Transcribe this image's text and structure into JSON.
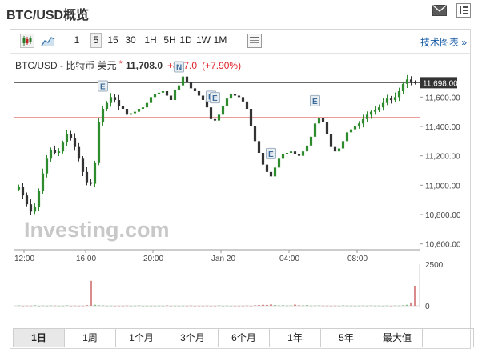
{
  "page": {
    "title": "BTC/USD概览",
    "icons": [
      "mail-icon",
      "document-icon"
    ]
  },
  "toolbar": {
    "chart_type_icons": [
      "candlestick-icon",
      "area-chart-icon"
    ],
    "intervals": [
      "1",
      "5",
      "15",
      "30",
      "1H",
      "5H",
      "1D",
      "1W",
      "1M"
    ],
    "active_interval": "5",
    "settings_icon": "chart-settings-icon",
    "tech_chart_link": "技术图表 »"
  },
  "quote": {
    "name": "BTC/USD - 比特币 美元",
    "star": "*",
    "price": "11,708.0",
    "change": "+857.0",
    "change_pct": "(+7.90%)",
    "up_color": "#e0242b"
  },
  "chart_data": {
    "type": "candlestick",
    "y_ticks": [
      "11,600.00",
      "11,400.00",
      "11,200.00",
      "11,000.00",
      "10,800.00",
      "10,600.00"
    ],
    "y_tick_values": [
      11600,
      11400,
      11200,
      11000,
      10800,
      10600
    ],
    "ylim": [
      10560,
      11760
    ],
    "x_ticks": [
      "12:00",
      "16:00",
      "20:00",
      "Jan 20",
      "04:00",
      "08:00"
    ],
    "current_price_label": "11,698.00",
    "current_price": 11698,
    "reference_line": 11460,
    "event_markers": [
      "E",
      "N",
      "E",
      "E",
      "E",
      "E"
    ],
    "watermark": "Investing.com",
    "closes": [
      10990,
      10930,
      10870,
      10820,
      10850,
      10960,
      11080,
      11180,
      11240,
      11220,
      11230,
      11290,
      11350,
      11320,
      11260,
      11180,
      11090,
      11020,
      11010,
      11150,
      11430,
      11520,
      11560,
      11600,
      11580,
      11540,
      11520,
      11480,
      11490,
      11500,
      11520,
      11530,
      11560,
      11600,
      11620,
      11630,
      11640,
      11610,
      11580,
      11650,
      11680,
      11740,
      11700,
      11660,
      11640,
      11610,
      11580,
      11530,
      11450,
      11440,
      11480,
      11540,
      11590,
      11620,
      11610,
      11600,
      11570,
      11520,
      11400,
      11300,
      11220,
      11140,
      11090,
      11060,
      11120,
      11180,
      11210,
      11220,
      11230,
      11210,
      11200,
      11230,
      11270,
      11330,
      11420,
      11460,
      11430,
      11350,
      11260,
      11230,
      11250,
      11300,
      11360,
      11380,
      11400,
      11420,
      11450,
      11480,
      11500,
      11510,
      11530,
      11560,
      11590,
      11580,
      11600,
      11640,
      11690,
      11720,
      11700,
      11698
    ],
    "volume_axis": [
      "2500",
      "0"
    ],
    "volume_max": 2500,
    "volumes": [
      20,
      0,
      10,
      5,
      30,
      0,
      15,
      0,
      20,
      10,
      0,
      5,
      25,
      0,
      10,
      0,
      5,
      40,
      1500,
      60,
      30,
      20,
      0,
      10,
      0,
      5,
      0,
      15,
      0,
      10,
      20,
      0,
      5,
      0,
      0,
      10,
      0,
      20,
      0,
      5,
      0,
      10,
      0,
      15,
      0,
      5,
      0,
      10,
      0,
      0,
      20,
      0,
      10,
      0,
      5,
      0,
      0,
      15,
      0,
      30,
      40,
      60,
      50,
      80,
      40,
      20,
      30,
      10,
      20,
      70,
      30,
      20,
      40,
      10,
      15,
      20,
      10,
      5,
      0,
      10,
      0,
      20,
      10,
      5,
      0,
      10,
      15,
      0,
      20,
      5,
      10,
      0,
      15,
      0,
      20,
      10,
      30,
      60,
      200,
      1200
    ]
  },
  "ranges": {
    "items": [
      "1日",
      "1周",
      "1个月",
      "3个月",
      "6个月",
      "1年",
      "5年",
      "最大值"
    ],
    "active": "1日"
  }
}
